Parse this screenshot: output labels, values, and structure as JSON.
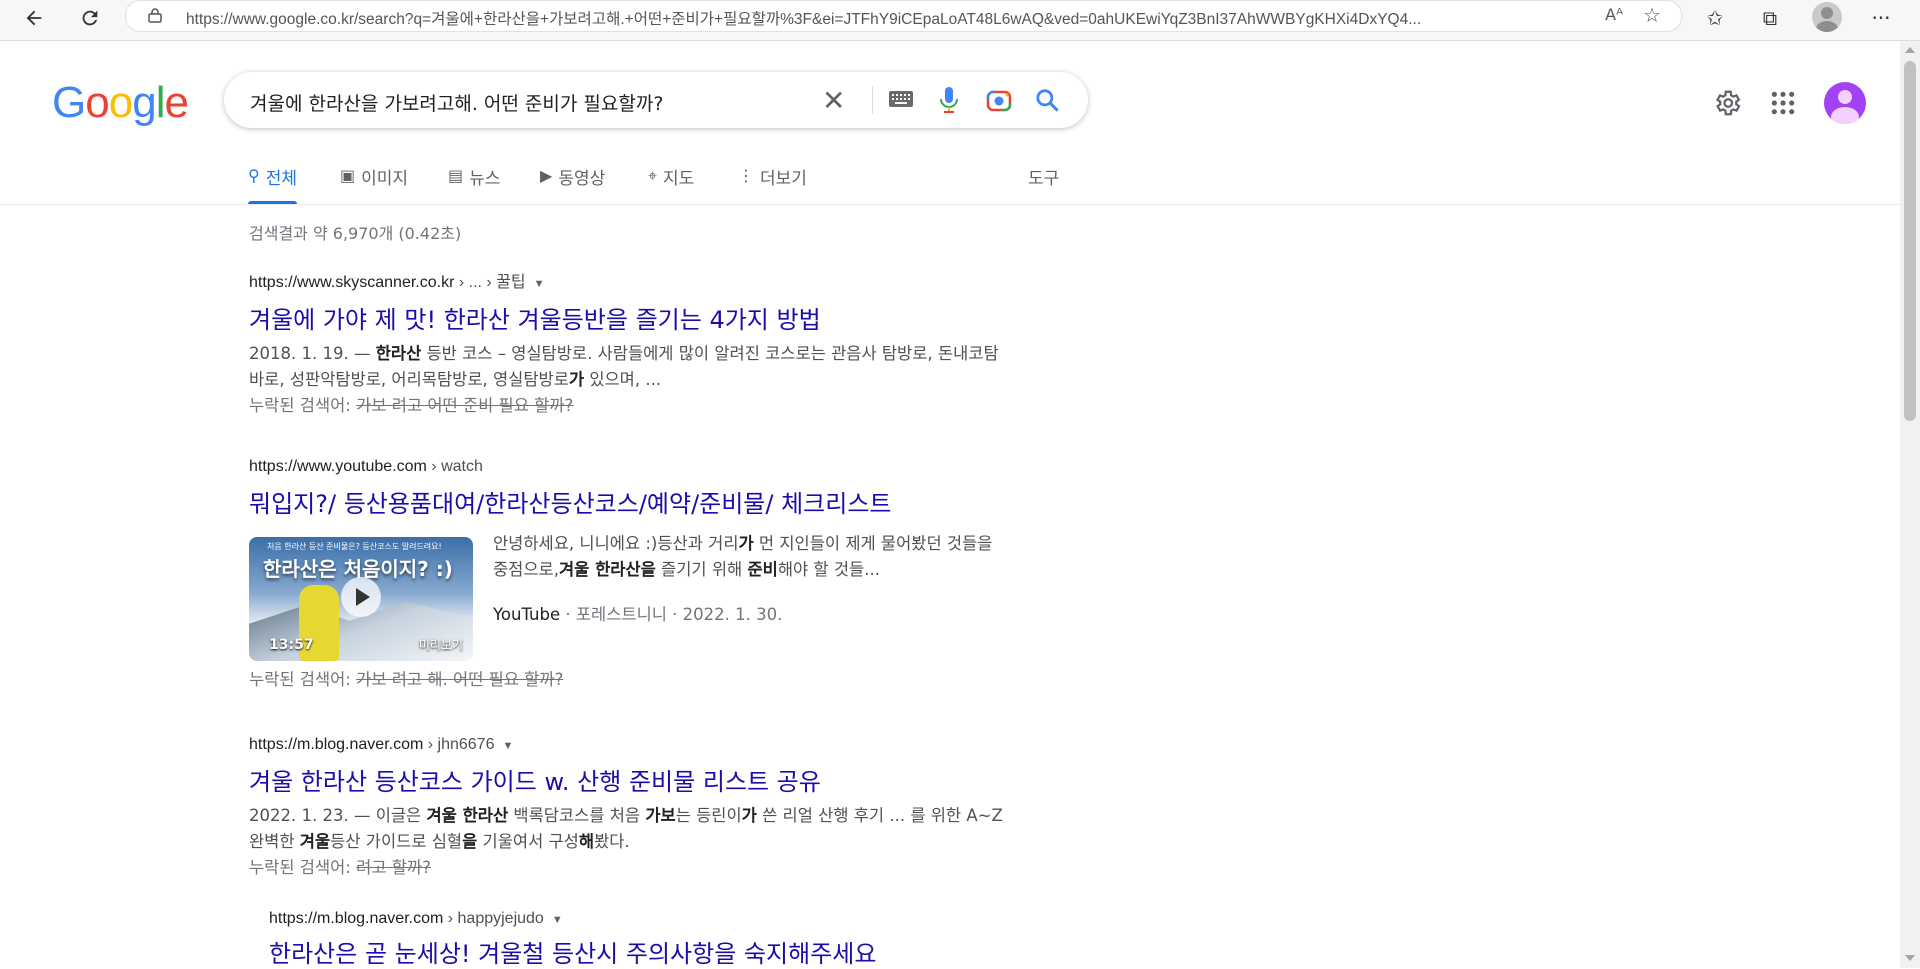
{
  "browser": {
    "url": "https://www.google.co.kr/search?q=겨울에+한라산을+가보려고해.+어떤+준비가+필요할까%3F&ei=JTFhY9iCEpaLoAT48L6wAQ&ved=0ahUKEwiYqZ3BnI37AhWWBYgKHXi4DxYQ4...",
    "read_aloud": "Aᴬ"
  },
  "google": {
    "logo": [
      "G",
      "o",
      "o",
      "g",
      "l",
      "e"
    ],
    "logo_colors": [
      "#4285f4",
      "#ea4335",
      "#fbbc05",
      "#4285f4",
      "#34a853",
      "#ea4335"
    ],
    "query": "겨울에 한라산을 가보려고해. 어떤 준비가 필요할까?"
  },
  "tabs": [
    {
      "label": "전체",
      "icon": "search-icon"
    },
    {
      "label": "이미지",
      "icon": "image-icon"
    },
    {
      "label": "뉴스",
      "icon": "news-icon"
    },
    {
      "label": "동영상",
      "icon": "video-icon"
    },
    {
      "label": "지도",
      "icon": "map-pin-icon"
    },
    {
      "label": "더보기",
      "icon": "more-vert-icon"
    }
  ],
  "tools_label": "도구",
  "stats": "검색결과 약 6,970개 (0.42초)",
  "results": [
    {
      "site": "https://www.skyscanner.co.kr",
      "crumb": " › ... › 꿀팁",
      "title": "겨울에 가야 제 맛! 한라산 겨울등반을 즐기는 4가지 방법",
      "snippet_parts": [
        "2018. 1. 19. — ",
        "한라산",
        " 등반 코스 – 영실탐방로. 사람들에게 많이 알려진 코스로는 관음사 탐방로, 돈내코탐바로, 성판악탐방로, 어리목탐방로, 영실탐방로",
        "가",
        " 있으며, ..."
      ],
      "missing_label": "누락된 검색어: ",
      "missing_terms": "가보 려고 어떤 준비 필요 할까?"
    },
    {
      "site": "https://www.youtube.com",
      "crumb": " › watch",
      "title": "뭐입지?/ 등산용품대여/한라산등산코스/예약/준비물/ 체크리스트",
      "thumb_title": "한라산은 처음이지? :)",
      "thumb_small": "처음 한라산 등산 준비물은? 등산코스도 알려드려요!",
      "duration": "13:57",
      "preview": "미리보기",
      "snippet_parts": [
        "안녕하세요, 니니에요 :)등산과 거리",
        "가",
        " 먼 지인들이 제게 물어봤던 것들을 중점으로,",
        "겨울 한라산을",
        " 즐기기 위해 ",
        "준비",
        "해야 할 것들..."
      ],
      "source": "YouTube",
      "meta": " · 포레스트니니 · 2022. 1. 30.",
      "missing_label": "누락된 검색어: ",
      "missing_terms": "가보 려고 해. 어떤 필요 할까?"
    },
    {
      "site": "https://m.blog.naver.com",
      "crumb": " › jhn6676",
      "title": "겨울 한라산 등산코스 가이드 w. 산행 준비물 리스트 공유",
      "snippet_parts": [
        "2022. 1. 23. — 이글은 ",
        "겨울 한라산",
        " 백록담코스를 처음 ",
        "가보",
        "는 등린이",
        "가",
        " 쓴 리얼 산행 후기 ... 를 위한 A~Z 완벽한 ",
        "겨울",
        "등산 가이드로 심혈",
        "을",
        " 기울여서 구성",
        "해",
        "봤다."
      ],
      "missing_label": "누락된 검색어: ",
      "missing_terms": "려고 할까?"
    },
    {
      "site": "https://m.blog.naver.com",
      "crumb": " › happyjejudo",
      "title": "한라산은 곧 눈세상! 겨울철 등산시 주의사항을 숙지해주세요"
    }
  ]
}
